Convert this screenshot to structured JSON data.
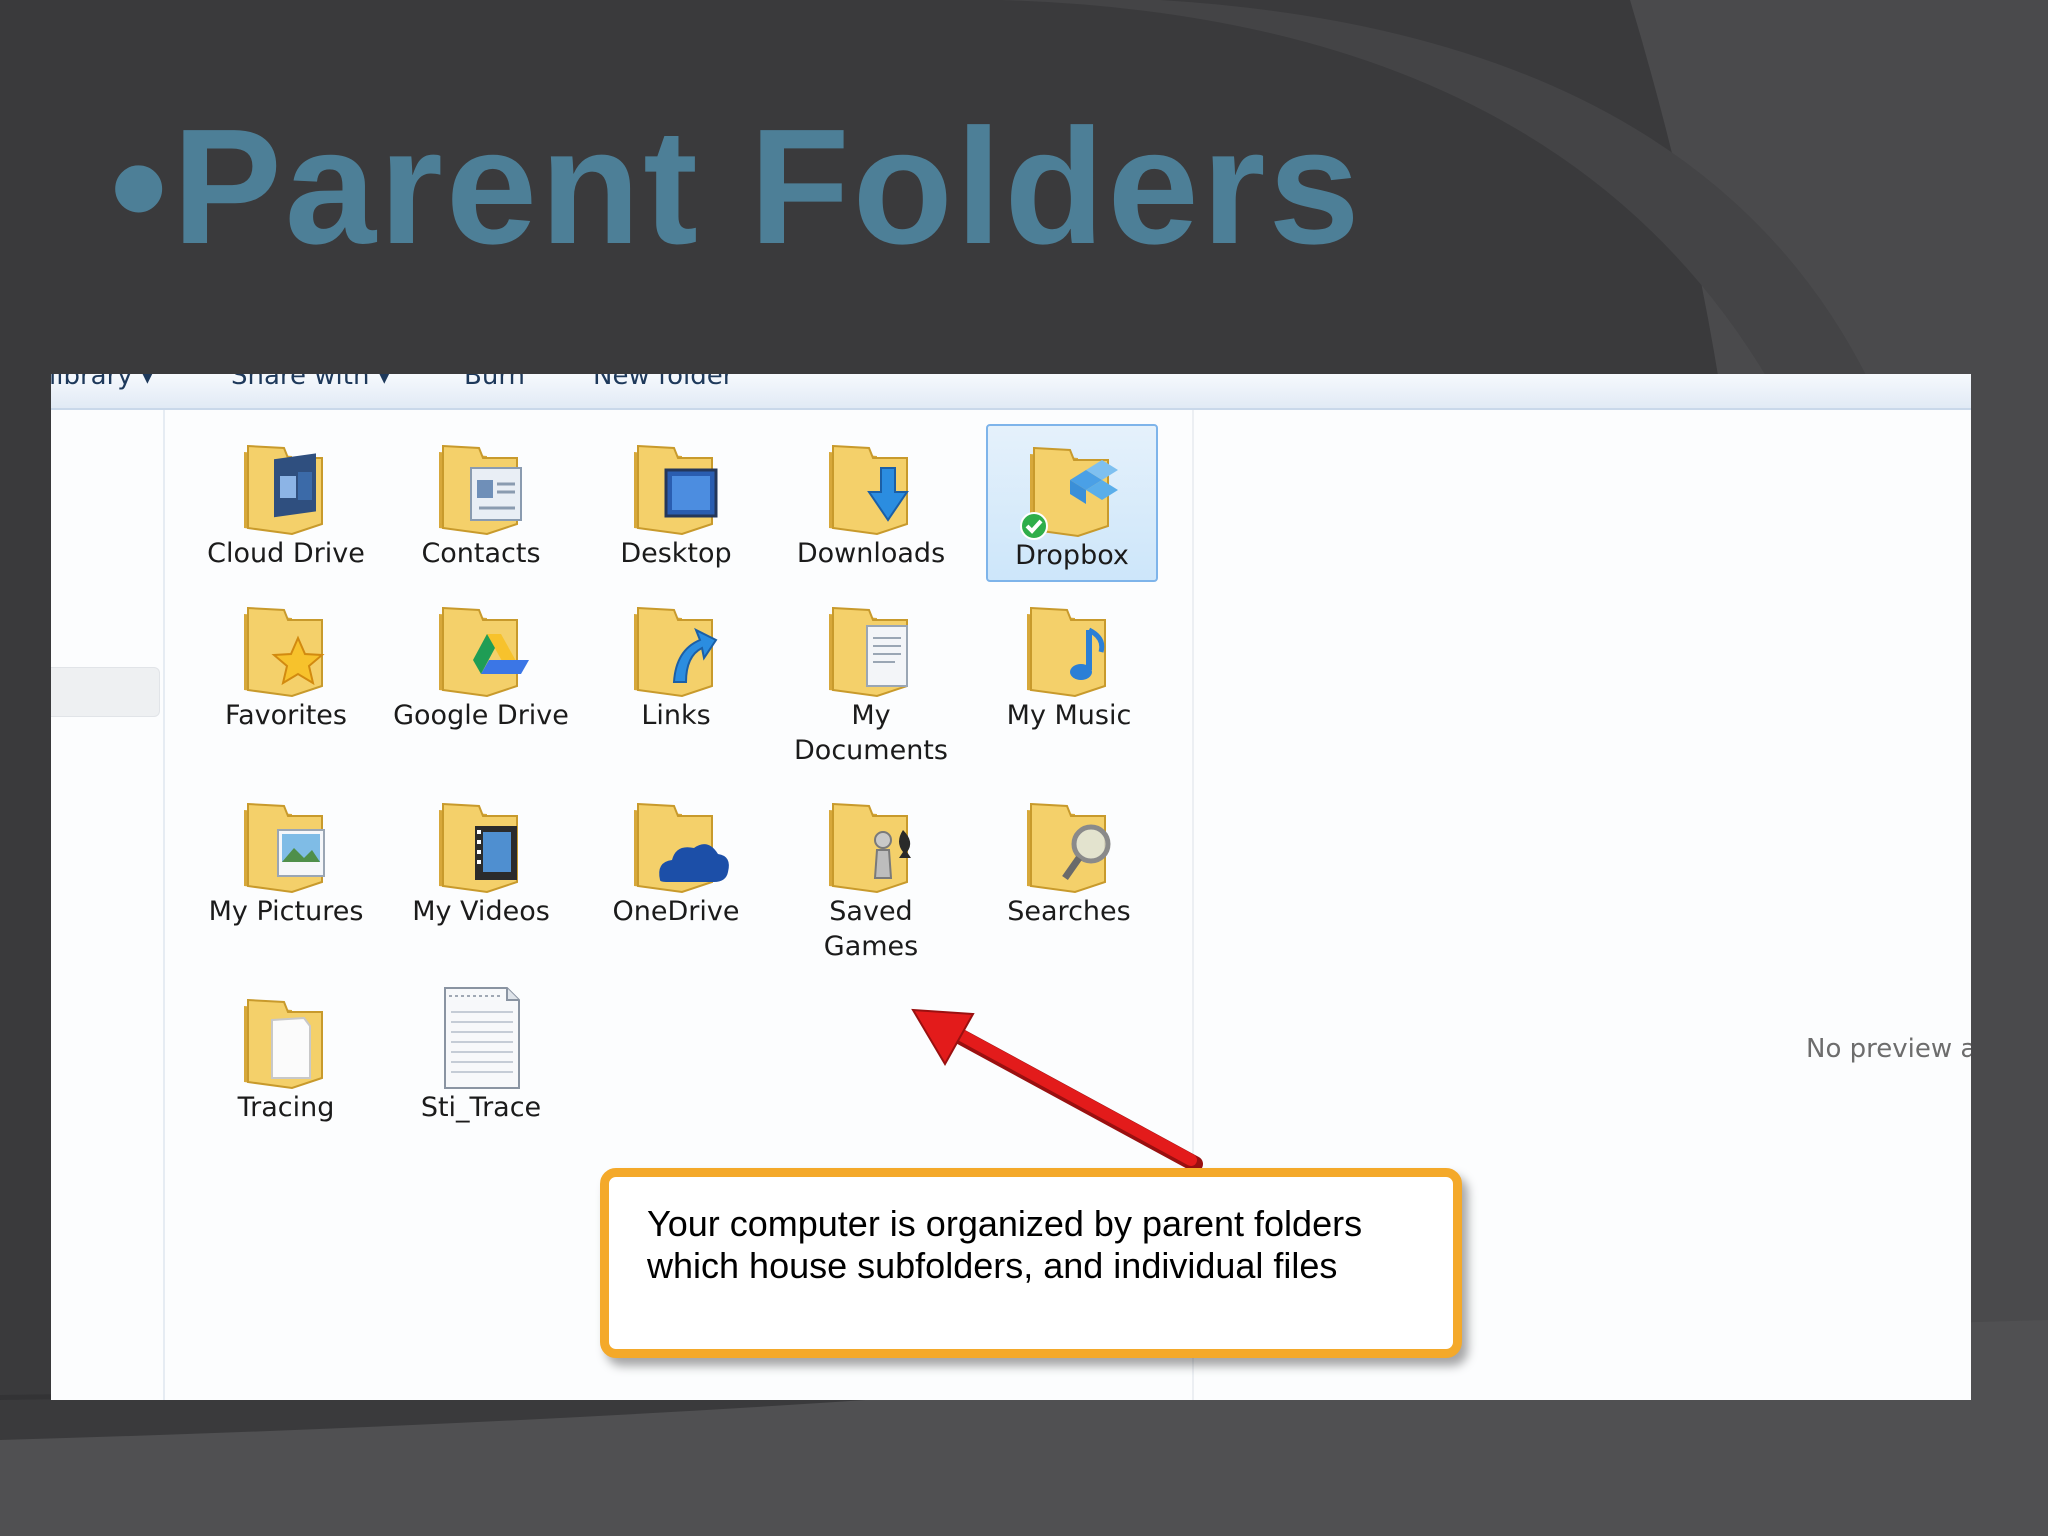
{
  "slide": {
    "title_bullet": "•",
    "title": "Parent Folders",
    "title_color": "#4d7f97",
    "background_color": "#3a3a3c"
  },
  "explorer": {
    "toolbar": [
      "library ▾",
      "Share with ▾",
      "Burn",
      "New folder"
    ],
    "items": [
      {
        "label": "Cloud Drive",
        "icon": "folder-cloud-drive-icon",
        "type": "folder"
      },
      {
        "label": "Contacts",
        "icon": "folder-contacts-icon",
        "type": "folder"
      },
      {
        "label": "Desktop",
        "icon": "folder-desktop-icon",
        "type": "folder"
      },
      {
        "label": "Downloads",
        "icon": "folder-downloads-icon",
        "type": "folder"
      },
      {
        "label": "Dropbox",
        "icon": "folder-dropbox-icon",
        "type": "folder",
        "selected": true
      },
      {
        "label": "Favorites",
        "icon": "folder-favorites-icon",
        "type": "folder"
      },
      {
        "label": "Google Drive",
        "icon": "folder-google-drive-icon",
        "type": "folder"
      },
      {
        "label": "Links",
        "icon": "folder-links-icon",
        "type": "folder"
      },
      {
        "label": "My Documents",
        "icon": "folder-documents-icon",
        "type": "folder"
      },
      {
        "label": "My Music",
        "icon": "folder-music-icon",
        "type": "folder"
      },
      {
        "label": "My Pictures",
        "icon": "folder-pictures-icon",
        "type": "folder"
      },
      {
        "label": "My Videos",
        "icon": "folder-videos-icon",
        "type": "folder"
      },
      {
        "label": "OneDrive",
        "icon": "folder-onedrive-icon",
        "type": "folder"
      },
      {
        "label": "Saved Games",
        "icon": "folder-saved-games-icon",
        "type": "folder"
      },
      {
        "label": "Searches",
        "icon": "folder-searches-icon",
        "type": "folder"
      },
      {
        "label": "Tracing",
        "icon": "folder-tracing-icon",
        "type": "folder"
      },
      {
        "label": "Sti_Trace",
        "icon": "text-file-icon",
        "type": "file"
      }
    ],
    "preview_text": "No preview av"
  },
  "callout": {
    "text": "Your computer is organized by parent folders which house subfolders, and individual files",
    "border_color": "#f4a92a"
  },
  "arrow_color": "#e31b1b"
}
